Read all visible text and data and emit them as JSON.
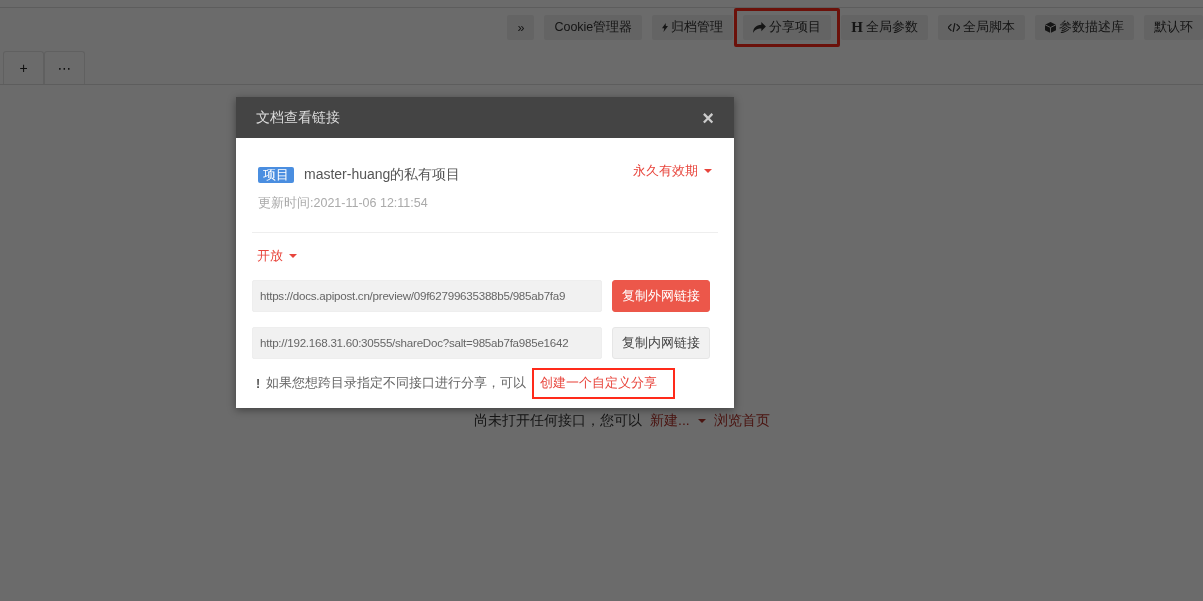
{
  "toolbar": {
    "buttons": [
      {
        "kind": "plain",
        "label": "»",
        "annotated": false
      },
      {
        "kind": "plain",
        "label": "Cookie管理器",
        "annotated": false
      },
      {
        "kind": "bolt",
        "label": "归档管理",
        "annotated": false
      },
      {
        "kind": "share",
        "label": "分享项目",
        "annotated": true
      },
      {
        "kind": "letter",
        "glyph": "H",
        "label": "全局参数",
        "annotated": false
      },
      {
        "kind": "code",
        "label": "全局脚本",
        "annotated": false
      },
      {
        "kind": "cube",
        "label": "参数描述库",
        "annotated": false
      },
      {
        "kind": "plain",
        "label": "默认环",
        "annotated": false
      }
    ]
  },
  "tabs": {
    "buttons": [
      "+",
      "⋯"
    ]
  },
  "empty_state": {
    "text": "尚未打开任何接口，您可以",
    "new_link": "新建...",
    "home_link": "浏览首页"
  },
  "dialog": {
    "title": "文档查看链接",
    "close": "×",
    "tag": "项目",
    "project_name": "master-huang的私有项目",
    "expiry": "永久有效期",
    "updated": "更新时间:2021-11-06 12:11:54",
    "access": "开放",
    "links": [
      {
        "url": "https://docs.apipost.cn/preview/09f62799635388b5/985ab7fa9",
        "button": "复制外网链接",
        "primary": true
      },
      {
        "url": "http://192.168.31.60:30555/shareDoc?salt=985ab7fa985e1642",
        "button": "复制内网链接",
        "primary": false
      }
    ],
    "notice": {
      "mark": "!",
      "text": "如果您想跨目录指定不同接口进行分享，可以",
      "link": "创建一个自定义分享",
      "annotated": true
    }
  }
}
